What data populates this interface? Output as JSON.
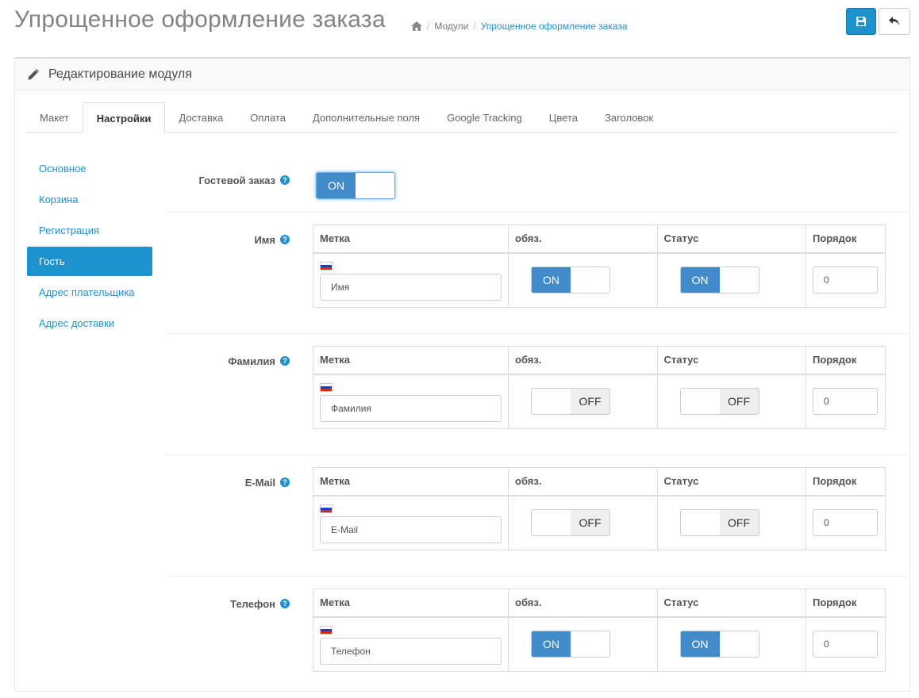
{
  "page": {
    "title": "Упрощенное оформление заказа",
    "breadcrumb": [
      "Модули",
      "Упрощенное оформление заказа"
    ]
  },
  "panel": {
    "heading": "Редактирование модуля"
  },
  "tabs": [
    "Макет",
    "Настройки",
    "Доставка",
    "Оплата",
    "Дополнительные поля",
    "Google Tracking",
    "Цвета",
    "Заголовок"
  ],
  "active_tab": "Настройки",
  "sidenav": [
    "Основное",
    "Корзина",
    "Регистрация",
    "Гость",
    "Адрес плательщика",
    "Адрес доставки"
  ],
  "active_side": "Гость",
  "guest_order": {
    "label": "Гостевой заказ",
    "toggle": "ON"
  },
  "table_headers": {
    "label": "Метка",
    "required": "обяз.",
    "status": "Статус",
    "order": "Порядок"
  },
  "fields": [
    {
      "name": "Имя",
      "value": "Имя",
      "required": "ON",
      "status": "ON",
      "order": "0"
    },
    {
      "name": "Фамилия",
      "value": "Фамилия",
      "required": "OFF",
      "status": "OFF",
      "order": "0"
    },
    {
      "name": "E-Mail",
      "value": "E-Mail",
      "required": "OFF",
      "status": "OFF",
      "order": "0"
    },
    {
      "name": "Телефон",
      "value": "Телефон",
      "required": "ON",
      "status": "ON",
      "order": "0"
    }
  ],
  "colors": {
    "accent": "#1e91cf",
    "toggle_on": "#428bca"
  }
}
